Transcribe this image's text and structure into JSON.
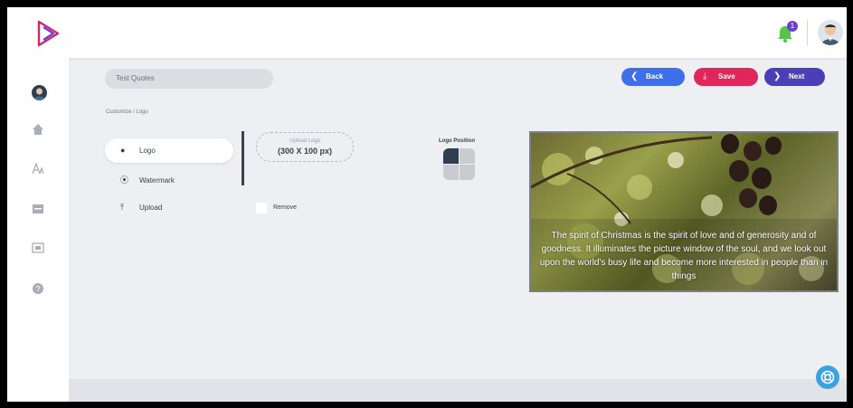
{
  "header": {
    "notification_count": "1",
    "icons": [
      "brand-logo-icon",
      "bell-icon",
      "user-avatar"
    ]
  },
  "sidebar": {
    "icons": [
      "user-avatar",
      "home-icon",
      "text-icon",
      "layout-icon",
      "media-icon",
      "help-icon"
    ]
  },
  "project": {
    "name": "Test Quotes"
  },
  "actions": {
    "back_label": "Back",
    "save_label": "Save",
    "next_label": "Next"
  },
  "breadcrumb": "Customize  /  Logo",
  "menu": {
    "items": [
      {
        "label": "Logo",
        "active": true
      },
      {
        "label": "Watermark",
        "active": false
      },
      {
        "label": "Upload",
        "active": false
      }
    ]
  },
  "upload": {
    "label": "Upload Logo",
    "size_hint": "(300 X 100 px)"
  },
  "remove_label": "Remove",
  "logo_position": {
    "label": "Logo Position",
    "selected": "top-left"
  },
  "preview": {
    "quote": "The spirit of Christmas is the spirit of love and of generosity and of goodness. It illuminates the picture window of the soul, and we look out upon the world's busy life and become more interested in people than in things"
  },
  "colors": {
    "back": "#3e6fe8",
    "save": "#e0265a",
    "next": "#4a3fb5",
    "help": "#3aa2e0"
  }
}
